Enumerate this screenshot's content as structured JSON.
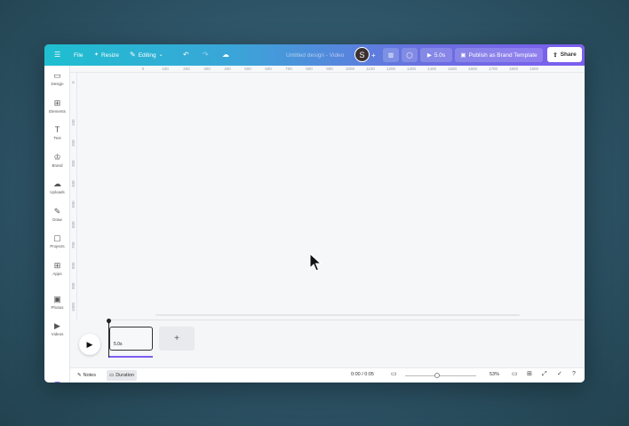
{
  "topbar": {
    "menu_icon": "hamburger-icon",
    "file": "File",
    "resize": "Resize",
    "editing": "Editing",
    "doc_title": "Untitled design - Video",
    "avatar_initial": "S",
    "add": "+",
    "duration": "5.0s",
    "publish": "Publish as Brand Template",
    "share": "Share"
  },
  "sidebar": {
    "items": [
      {
        "label": "Design",
        "icon": "▭"
      },
      {
        "label": "Elements",
        "icon": "⊞"
      },
      {
        "label": "Text",
        "icon": "T"
      },
      {
        "label": "Brand",
        "icon": "♔"
      },
      {
        "label": "Uploads",
        "icon": "☁"
      },
      {
        "label": "Draw",
        "icon": "✎"
      },
      {
        "label": "Projects",
        "icon": "▢"
      },
      {
        "label": "Apps",
        "icon": "⊞"
      },
      {
        "label": "Photos",
        "icon": "▣"
      },
      {
        "label": "Videos",
        "icon": "▶"
      }
    ]
  },
  "ruler": {
    "x_ticks": [
      "0",
      "100",
      "200",
      "300",
      "400",
      "500",
      "600",
      "700",
      "800",
      "900",
      "1000",
      "1100",
      "1200",
      "1300",
      "1400",
      "1500",
      "1600",
      "1700",
      "1800",
      "1900"
    ],
    "y_ticks": [
      "0",
      "100",
      "200",
      "300",
      "400",
      "500",
      "600",
      "700",
      "800",
      "900",
      "1000"
    ]
  },
  "timeline": {
    "clip_duration": "5.0s",
    "add_page": "+"
  },
  "bottombar": {
    "notes": "Notes",
    "duration": "Duration",
    "time": "0:00 / 0:05",
    "zoom_value": 53,
    "zoom": "53%"
  }
}
